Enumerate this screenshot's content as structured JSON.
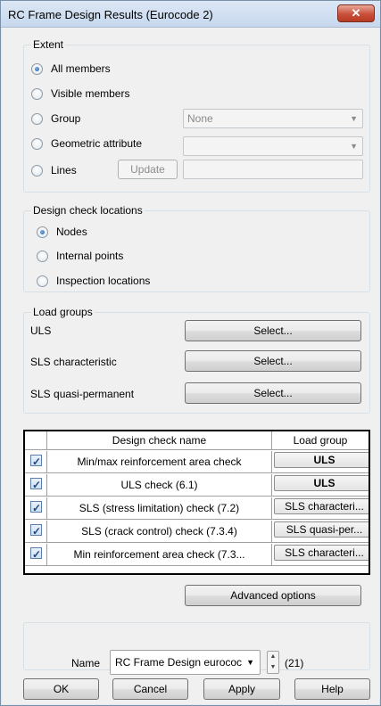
{
  "window": {
    "title": "RC Frame Design Results (Eurocode 2)",
    "close_symbol": "✕"
  },
  "extent": {
    "label": "Extent",
    "all_members": "All members",
    "visible_members": "Visible members",
    "group": "Group",
    "group_value": "None",
    "geometric_attribute": "Geometric attribute",
    "geometric_value": "",
    "lines": "Lines",
    "update": "Update",
    "lines_value": "",
    "selected": "all_members"
  },
  "design_check_locations": {
    "label": "Design check locations",
    "nodes": "Nodes",
    "internal_points": "Internal points",
    "inspection_locations": "Inspection locations",
    "selected": "nodes"
  },
  "load_groups": {
    "label": "Load groups",
    "uls": "ULS",
    "sls_characteristic": "SLS characteristic",
    "sls_quasi_permanent": "SLS quasi-permanent",
    "select_label": "Select..."
  },
  "checks_table": {
    "headers": [
      "Design check name",
      "Load group"
    ],
    "rows": [
      {
        "checked": true,
        "name": "Min/max reinforcement area check",
        "group": "ULS"
      },
      {
        "checked": true,
        "name": "ULS check (6.1)",
        "group": "ULS"
      },
      {
        "checked": true,
        "name": "SLS (stress limitation) check (7.2)",
        "group": "SLS characteri..."
      },
      {
        "checked": true,
        "name": "SLS (crack control) check (7.3.4)",
        "group": "SLS quasi-per..."
      },
      {
        "checked": true,
        "name": "Min reinforcement area check (7.3...",
        "group": "SLS characteri..."
      }
    ]
  },
  "advanced_options": "Advanced options",
  "name_section": {
    "label": "Name",
    "value": "RC Frame Design eurococ",
    "count": "(21)"
  },
  "buttons": {
    "ok": "OK",
    "cancel": "Cancel",
    "apply": "Apply",
    "help": "Help"
  },
  "icons": {
    "dropdown": "chevron-down-icon",
    "spin_up": "spin-up-icon",
    "spin_down": "spin-down-icon"
  }
}
